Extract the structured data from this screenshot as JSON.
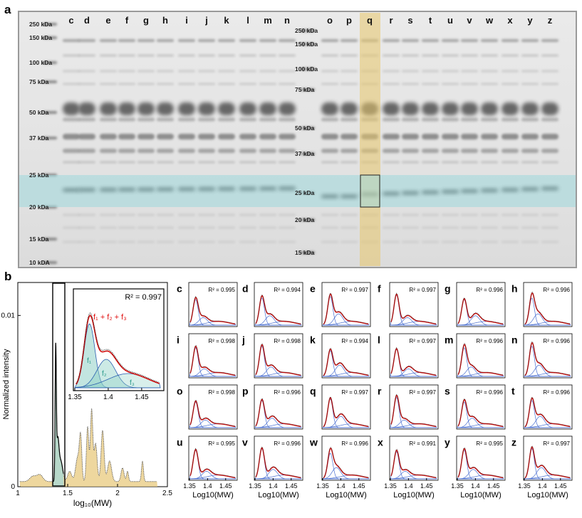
{
  "panel_a": {
    "label": "a",
    "markers_left": [
      "250 kDa",
      "150 kDa",
      "100 kDa",
      "75 kDa",
      "50 kDa",
      "37 kDa",
      "25 kDa",
      "20 kDa",
      "15 kDa",
      "10 kDA"
    ],
    "markers_mid": [
      "250 kDa",
      "150 kDa",
      "100 kDa",
      "75 kDa",
      "50 kDa",
      "37 kDa",
      "25 kDa",
      "20 kDa",
      "15 kDa"
    ],
    "lanes": [
      "c",
      "d",
      "e",
      "f",
      "g",
      "h",
      "i",
      "j",
      "k",
      "l",
      "m",
      "n",
      "o",
      "p",
      "q",
      "r",
      "s",
      "t",
      "u",
      "v",
      "w",
      "x",
      "y",
      "z"
    ],
    "highlighted_lane": "q",
    "highlight_colors": {
      "lane": "#e8c66a",
      "band_region": "#9fd8dc"
    }
  },
  "panel_b": {
    "label": "b",
    "ylabel": "Normalized intensity",
    "xlabel": "log₁₀(MW)",
    "xticks": [
      "1",
      "1.5",
      "2",
      "2.5"
    ],
    "yticks": [
      "0",
      "0.01"
    ],
    "inset": {
      "r2": "R² = 0.997",
      "legend": "f₁ + f₂ + f₃",
      "components": [
        "f₁",
        "f₂",
        "f₃"
      ],
      "xticks": [
        "1.35",
        "1.4",
        "1.45"
      ]
    }
  },
  "panel_c": {
    "xlabel": "Log10(MW)",
    "xticks": [
      "1.35",
      "1.4",
      "1.45"
    ],
    "fits": [
      {
        "lane": "c",
        "r2": "R² = 0.995"
      },
      {
        "lane": "d",
        "r2": "R² = 0.994"
      },
      {
        "lane": "e",
        "r2": "R² = 0.997"
      },
      {
        "lane": "f",
        "r2": "R² = 0.997"
      },
      {
        "lane": "g",
        "r2": "R² = 0.996"
      },
      {
        "lane": "h",
        "r2": "R² = 0.996"
      },
      {
        "lane": "i",
        "r2": "R² = 0.998"
      },
      {
        "lane": "j",
        "r2": "R² = 0.998"
      },
      {
        "lane": "k",
        "r2": "R² = 0.994"
      },
      {
        "lane": "l",
        "r2": "R² = 0.997"
      },
      {
        "lane": "m",
        "r2": "R² = 0.996"
      },
      {
        "lane": "n",
        "r2": "R² = 0.996"
      },
      {
        "lane": "o",
        "r2": "R² = 0.998"
      },
      {
        "lane": "p",
        "r2": "R² = 0.996"
      },
      {
        "lane": "q",
        "r2": "R² = 0.997"
      },
      {
        "lane": "r",
        "r2": "R² = 0.997"
      },
      {
        "lane": "s",
        "r2": "R² = 0.996"
      },
      {
        "lane": "t",
        "r2": "R² = 0.996"
      },
      {
        "lane": "u",
        "r2": "R² = 0.995"
      },
      {
        "lane": "v",
        "r2": "R² = 0.996"
      },
      {
        "lane": "w",
        "r2": "R² = 0.996"
      },
      {
        "lane": "x",
        "r2": "R² = 0.991"
      },
      {
        "lane": "y",
        "r2": "R² = 0.995"
      },
      {
        "lane": "z",
        "r2": "R² = 0.997"
      }
    ]
  }
}
